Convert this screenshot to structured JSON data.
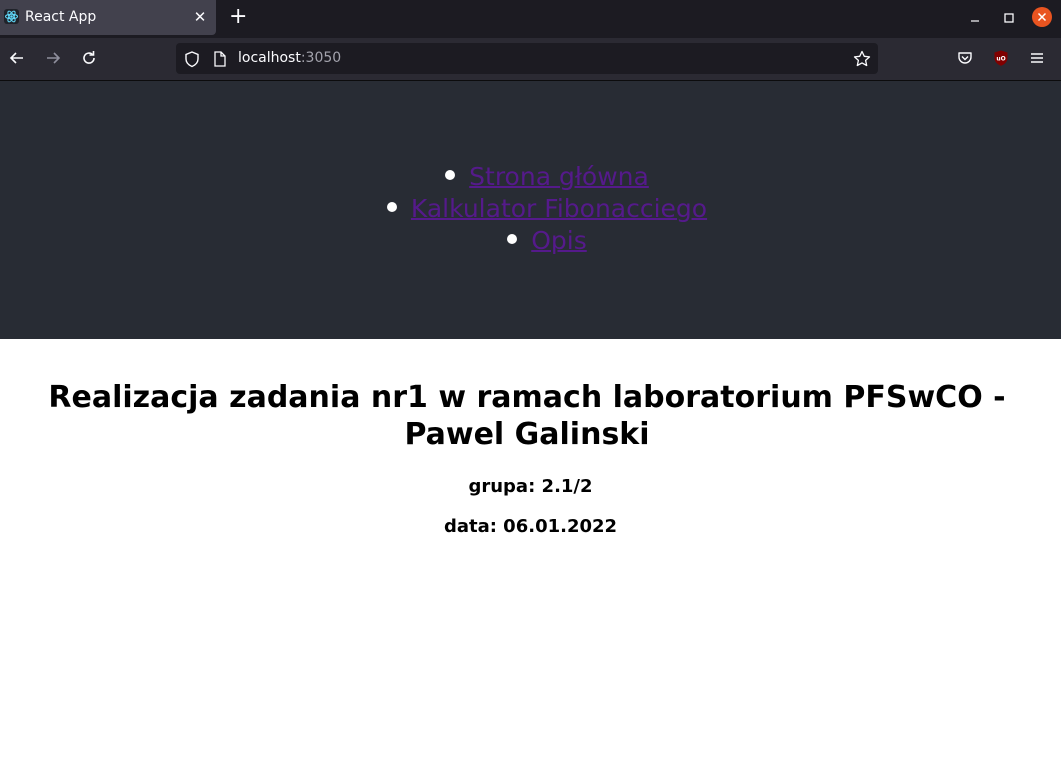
{
  "browser": {
    "tab": {
      "title": "React App"
    },
    "url": {
      "host": "localhost",
      "port": ":3050"
    }
  },
  "nav": {
    "items": [
      {
        "label": "Strona główna"
      },
      {
        "label": "Kalkulator Fibonacciego"
      },
      {
        "label": "Opis"
      }
    ]
  },
  "content": {
    "title": "Realizacja zadania nr1 w ramach laboratorium PFSwCO - Pawel Galinski",
    "group": "grupa: 2.1/2",
    "date": "data: 06.01.2022"
  },
  "colors": {
    "header_bg": "#282c34",
    "link": "#551a8b",
    "browser_bg": "#1c1b22",
    "close_button": "#e95420"
  }
}
